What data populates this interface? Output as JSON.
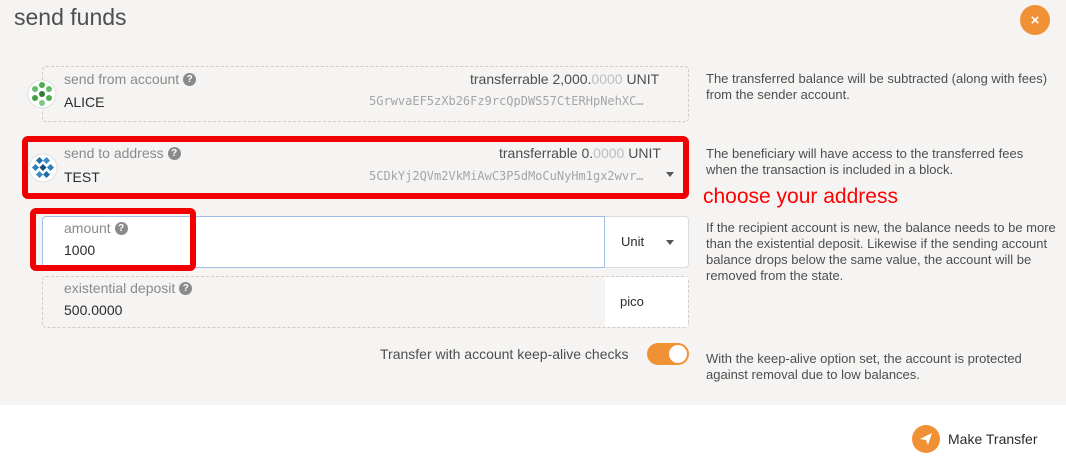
{
  "modal": {
    "title": "send funds",
    "close_icon": "×"
  },
  "send_from": {
    "label": "send from account",
    "help": "?",
    "transferrable_label": "transferrable",
    "balance_main": "2,000.",
    "balance_decimals": "0000",
    "unit": "UNIT",
    "account_name": "ALICE",
    "address": "5GrwvaEF5zXb26Fz9rcQpDWS57CtERHpNehXC…",
    "help_text": "The transferred balance will be subtracted (along with fees) from the sender account."
  },
  "send_to": {
    "label": "send to address",
    "help": "?",
    "transferrable_label": "transferrable",
    "balance_main": "0.",
    "balance_decimals": "0000",
    "unit": "UNIT",
    "account_name": "TEST",
    "address": "5CDkYj2QVm2VkMiAwC3P5dMoCuNyHm1gx2wvr…",
    "help_text": "The beneficiary will have access to the transferred fees when the transaction is included in a block."
  },
  "annotation": {
    "text": "choose your address",
    "color": "#ff0000"
  },
  "amount": {
    "label": "amount",
    "help": "?",
    "value": "1000",
    "unit_select": "Unit",
    "help_text": "If the recipient account is new, the balance needs to be more than the existential deposit. Likewise if the sending account balance drops below the same value, the account will be removed from the state."
  },
  "existential_deposit": {
    "label": "existential deposit",
    "help": "?",
    "value": "500.0000",
    "unit": "pico"
  },
  "keep_alive": {
    "label": "Transfer with account keep-alive checks",
    "enabled": true,
    "help_text": "With the keep-alive option set, the account is protected against removal due to low balances."
  },
  "footer": {
    "make_transfer_label": "Make Transfer",
    "icon": "send-icon"
  },
  "colors": {
    "accent": "#f19135",
    "highlight_red": "#f00000",
    "background": "#f5f4f3"
  }
}
